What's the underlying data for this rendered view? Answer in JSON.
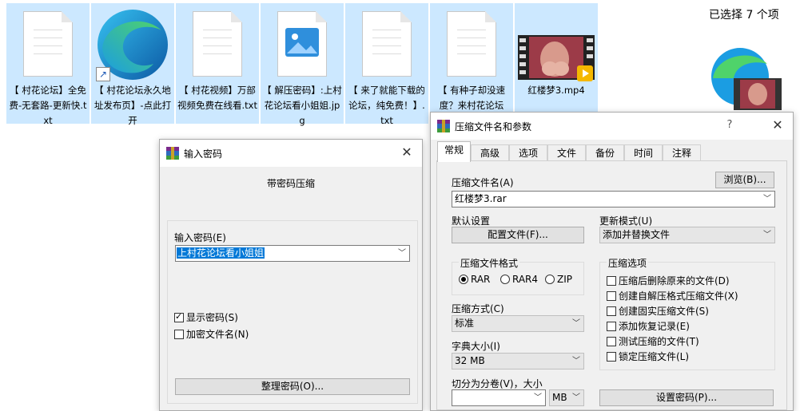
{
  "explorer": {
    "files": [
      {
        "name": "【 村花论坛】全免费-无套路-更新快.txt",
        "icon": "text-file-icon"
      },
      {
        "name": "【 村花论坛永久地址发布页】-点此打开",
        "icon": "edge-shortcut-icon"
      },
      {
        "name": "【 村花视频】万部视频免费在线看.txt",
        "icon": "text-file-icon"
      },
      {
        "name": "【 解压密码】:上村花论坛看小姐姐.jpg",
        "icon": "image-file-icon"
      },
      {
        "name": "【 来了就能下载的论坛，纯免费！】.txt",
        "icon": "text-file-icon"
      },
      {
        "name": "【 有种子却没速度？来村花论坛",
        "icon": "text-file-icon"
      },
      {
        "name": "红楼梦3.mp4",
        "icon": "video-file-icon"
      }
    ],
    "selection_text": "已选择 7 个项"
  },
  "password_dialog": {
    "title": "输入密码",
    "heading": "带密码压缩",
    "password_label": "输入密码(E)",
    "password_value": "上村花论坛看小姐姐",
    "show_password": "显示密码(S)",
    "show_password_checked": true,
    "encrypt_names": "加密文件名(N)",
    "encrypt_names_checked": false,
    "organize_button": "整理密码(O)..."
  },
  "archive_dialog": {
    "title": "压缩文件名和参数",
    "help": "?",
    "tabs": [
      "常规",
      "高级",
      "选项",
      "文件",
      "备份",
      "时间",
      "注释"
    ],
    "active_tab": "常规",
    "archive_name_label": "压缩文件名(A)",
    "browse_button": "浏览(B)...",
    "archive_name_value": "红楼梦3.rar",
    "default_settings_label": "默认设置",
    "profiles_button": "配置文件(F)...",
    "update_mode_label": "更新模式(U)",
    "update_mode_value": "添加并替换文件",
    "format_group": "压缩文件格式",
    "formats": [
      "RAR",
      "RAR4",
      "ZIP"
    ],
    "format_selected": "RAR",
    "method_label": "压缩方式(C)",
    "method_value": "标准",
    "dict_label": "字典大小(I)",
    "dict_value": "32 MB",
    "split_label": "切分为分卷(V)，大小",
    "split_unit": "MB",
    "options_group": "压缩选项",
    "options": [
      {
        "label": "压缩后删除原来的文件(D)",
        "checked": false
      },
      {
        "label": "创建自解压格式压缩文件(X)",
        "checked": false
      },
      {
        "label": "创建固实压缩文件(S)",
        "checked": false
      },
      {
        "label": "添加恢复记录(E)",
        "checked": false
      },
      {
        "label": "测试压缩的文件(T)",
        "checked": false
      },
      {
        "label": "锁定压缩文件(L)",
        "checked": false
      }
    ],
    "set_password_button": "设置密码(P)..."
  },
  "colors": {
    "selection": "#cce8ff",
    "dialog_bg": "#f0f0f0",
    "text_highlight": "#0078d7"
  }
}
